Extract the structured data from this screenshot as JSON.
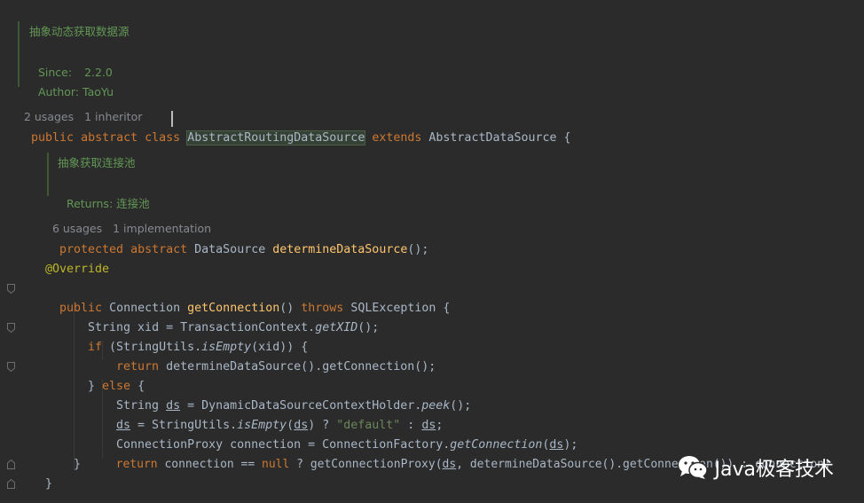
{
  "class_doc": {
    "title": "抽象动态获取数据源",
    "since_label": "Since:",
    "since_value": "2.2.0",
    "author_label": "Author:",
    "author_value": "TaoYu"
  },
  "class_hint": {
    "usages": "2 usages",
    "inheritors": "1 inheritor"
  },
  "class_decl": {
    "kw1": "public",
    "kw2": "abstract",
    "kw3": "class",
    "name": "AbstractRoutingDataSource",
    "extends_kw": "extends",
    "parent": "AbstractDataSource",
    "brace": "{"
  },
  "method_doc": {
    "title": "抽象获取连接池",
    "returns_label": "Returns:",
    "returns_value": "连接池"
  },
  "method_hint": {
    "usages": "6 usages",
    "implementations": "1 implementation"
  },
  "code": {
    "abstract_method": {
      "kw1": "protected",
      "kw2": "abstract",
      "type": "DataSource",
      "name": "determineDataSource",
      "tail": "();"
    },
    "annotation": "@Override",
    "get_conn_sig": {
      "kw": "public",
      "type": "Connection",
      "name": "getConnection",
      "paren": "()",
      "throws_kw": "throws",
      "ex": "SQLException {"
    },
    "l_xid": {
      "a": "String xid = TransactionContext.",
      "m": "getXID",
      "b": "();"
    },
    "l_if": {
      "kw": "if",
      "a": "(StringUtils.",
      "m": "isEmpty",
      "b": "(xid)) {"
    },
    "l_ret1": {
      "kw": "return",
      "a": "determineDataSource().getConnection();"
    },
    "l_else": {
      "a": "} ",
      "kw": "else",
      "b": " {"
    },
    "l_ds": {
      "a": "String ",
      "v": "ds",
      "b": " = DynamicDataSourceContextHolder.",
      "m": "peek",
      "c": "();"
    },
    "l_ds2": {
      "v1": "ds",
      "a": " = StringUtils.",
      "m": "isEmpty",
      "b": "(",
      "v2": "ds",
      "c": ") ? ",
      "s": "\"default\"",
      "d": " : ",
      "v3": "ds",
      "e": ";"
    },
    "l_proxy": {
      "a": "ConnectionProxy connection = ConnectionFactory.",
      "m": "getConnection",
      "b": "(",
      "v": "ds",
      "c": ");"
    },
    "l_ret2": {
      "kw": "return",
      "a": " connection == ",
      "nul": "null",
      "b": " ? getConnectionProxy(",
      "v": "ds",
      "c": ", determineDataSource().getConnection()) : connection;"
    },
    "close_inner": "}",
    "close_method": "}"
  },
  "watermark": {
    "text": "Java极客技术",
    "icon": "wechat-icon"
  }
}
